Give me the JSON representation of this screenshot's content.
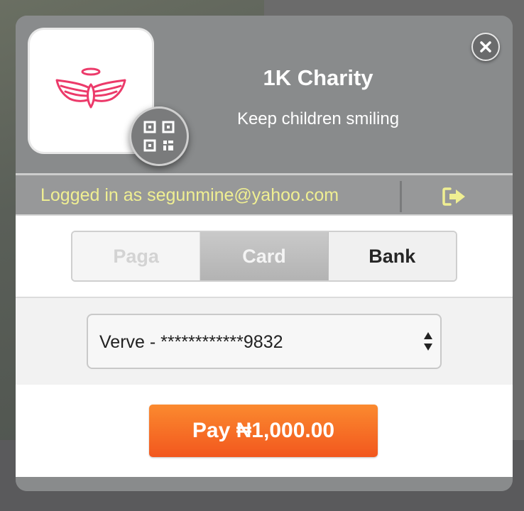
{
  "org": {
    "name": "1K Charity",
    "tagline": "Keep children smiling"
  },
  "session": {
    "logged_in_text": "Logged in as segunmine@yahoo.com"
  },
  "tabs": [
    {
      "label": "Paga",
      "state": "disabled"
    },
    {
      "label": "Card",
      "state": "selected"
    },
    {
      "label": "Bank",
      "state": "normal"
    }
  ],
  "card_select": {
    "selected": "Verve - ************9832"
  },
  "pay_button": {
    "label": "Pay ₦1,000.00"
  },
  "icons": {
    "logo": "angel-wings-halo-logo",
    "qr": "qr-code-icon",
    "close": "close-icon",
    "logout": "logout-icon",
    "select": "select-arrows-icon"
  },
  "colors": {
    "brand_pink": "#ec3a6a",
    "login_text": "#f0ef92",
    "pay_orange": "#f46a24"
  }
}
